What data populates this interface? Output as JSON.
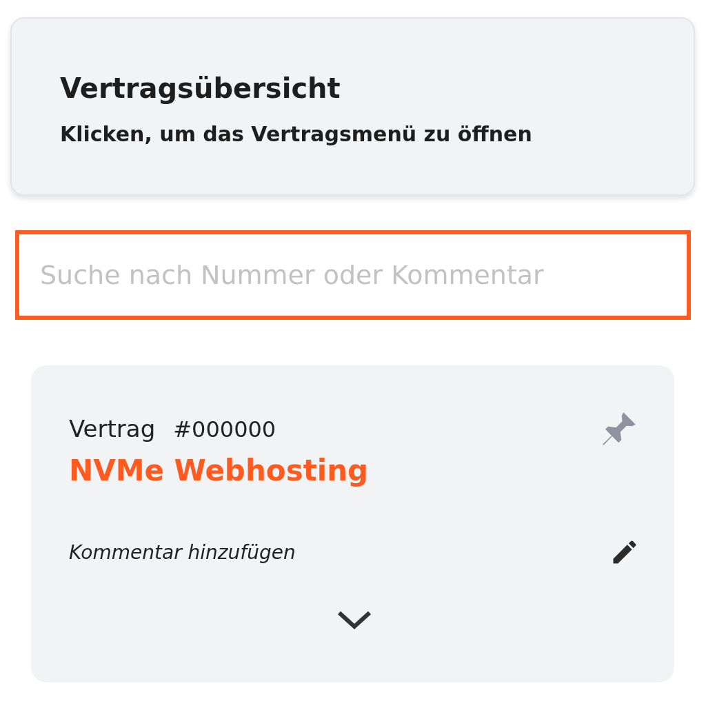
{
  "header": {
    "title": "Vertragsübersicht",
    "subtitle": "Klicken, um das Vertragsmenü zu öffnen"
  },
  "search": {
    "placeholder": "Suche nach Nummer oder Kommentar"
  },
  "contracts": [
    {
      "label": "Vertrag",
      "number": "#000000",
      "product": "NVMe Webhosting",
      "comment": "Kommentar hinzufügen",
      "pinned": false,
      "expanded": false
    }
  ]
}
